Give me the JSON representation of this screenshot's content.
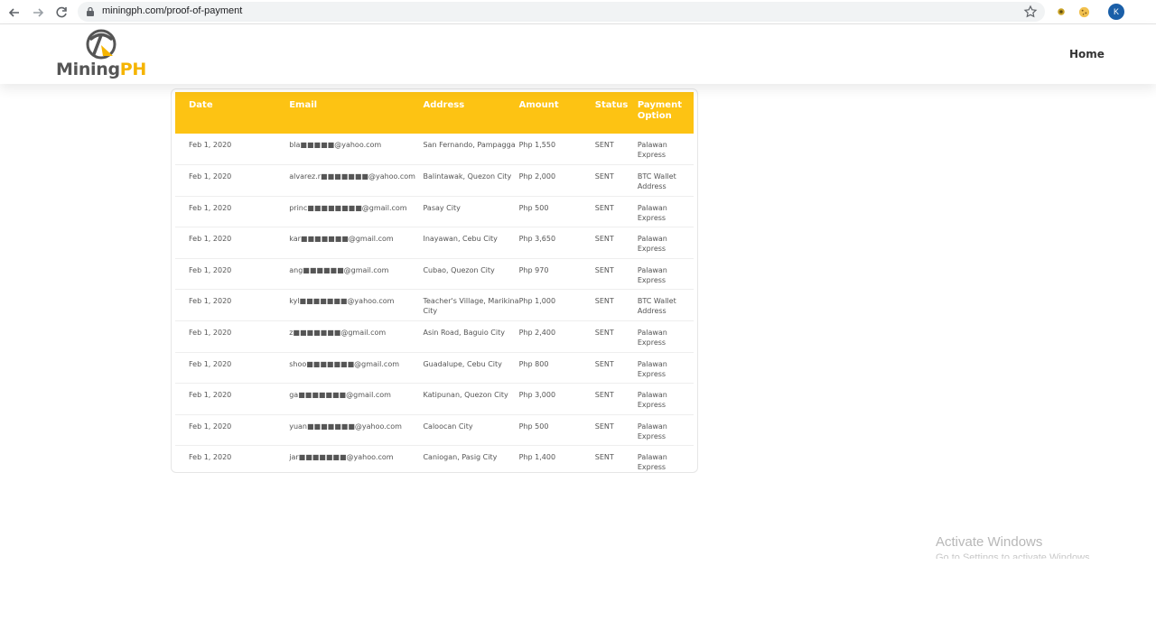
{
  "browser": {
    "url": "miningph.com/proof-of-payment",
    "profile_initial": "K"
  },
  "site": {
    "logo_mining": "Mining",
    "logo_ph": "PH",
    "nav_home": "Home"
  },
  "table": {
    "headers": {
      "date": "Date",
      "email": "Email",
      "address": "Address",
      "amount": "Amount",
      "status": "Status",
      "payment": "Payment Option"
    },
    "rows": [
      {
        "date": "Feb 1, 2020",
        "email": "bla■■■■■@yahoo.com",
        "address": "San Fernando, Pampagga",
        "amount": "Php 1,550",
        "status": "SENT",
        "payment": "Palawan Express"
      },
      {
        "date": "Feb 1, 2020",
        "email": "alvarez.r■■■■■■■@yahoo.com",
        "address": "Balintawak, Quezon City",
        "amount": "Php 2,000",
        "status": "SENT",
        "payment": "BTC Wallet Address"
      },
      {
        "date": "Feb 1, 2020",
        "email": "princ■■■■■■■■@gmail.com",
        "address": "Pasay City",
        "amount": "Php 500",
        "status": "SENT",
        "payment": "Palawan Express"
      },
      {
        "date": "Feb 1, 2020",
        "email": "kar■■■■■■■@gmail.com",
        "address": "Inayawan, Cebu City",
        "amount": "Php 3,650",
        "status": "SENT",
        "payment": "Palawan Express"
      },
      {
        "date": "Feb 1, 2020",
        "email": "ang■■■■■■@gmail.com",
        "address": "Cubao, Quezon City",
        "amount": "Php 970",
        "status": "SENT",
        "payment": "Palawan Express"
      },
      {
        "date": "Feb 1, 2020",
        "email": "kyl■■■■■■■@yahoo.com",
        "address": "Teacher's Village, Marikina City",
        "amount": "Php 1,000",
        "status": "SENT",
        "payment": "BTC Wallet Address"
      },
      {
        "date": "Feb 1, 2020",
        "email": "z■■■■■■■@gmail.com",
        "address": "Asin Road, Baguio City",
        "amount": "Php 2,400",
        "status": "SENT",
        "payment": "Palawan Express"
      },
      {
        "date": "Feb 1, 2020",
        "email": "shoo■■■■■■■@gmail.com",
        "address": "Guadalupe, Cebu City",
        "amount": "Php 800",
        "status": "SENT",
        "payment": "Palawan Express"
      },
      {
        "date": "Feb 1, 2020",
        "email": "ga■■■■■■■@gmail.com",
        "address": "Katipunan, Quezon City",
        "amount": "Php 3,000",
        "status": "SENT",
        "payment": "Palawan Express"
      },
      {
        "date": "Feb 1, 2020",
        "email": "yuan■■■■■■■@yahoo.com",
        "address": "Caloocan City",
        "amount": "Php 500",
        "status": "SENT",
        "payment": "Palawan Express"
      },
      {
        "date": "Feb 1, 2020",
        "email": "jar■■■■■■■@yahoo.com",
        "address": "Caniogan, Pasig City",
        "amount": "Php 1,400",
        "status": "SENT",
        "payment": "Palawan Express"
      }
    ]
  },
  "watermark": {
    "title": "Activate Windows",
    "subtitle": "Go to Settings to activate Windows."
  },
  "colors": {
    "accent": "#fdc313",
    "profile": "#1a5fa8"
  }
}
